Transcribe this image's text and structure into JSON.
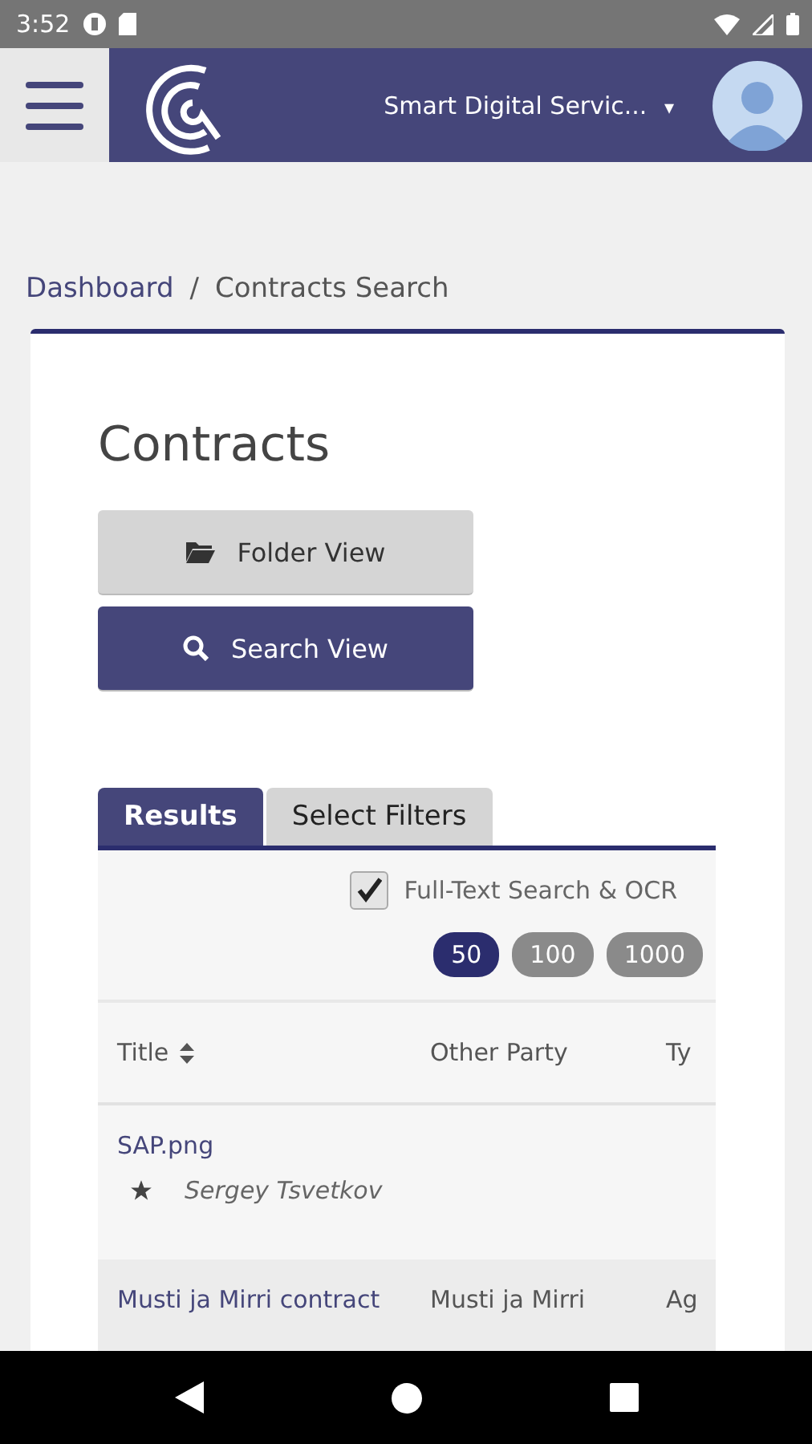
{
  "status_bar": {
    "time": "3:52"
  },
  "header": {
    "organization": "Smart Digital Servic...",
    "caret": "▾"
  },
  "breadcrumb": [
    {
      "label": "Dashboard",
      "kind": "link"
    },
    {
      "label": "Contracts Search",
      "kind": "current"
    }
  ],
  "breadcrumb_separator": "/",
  "page_title": "Contracts",
  "view_buttons": [
    {
      "label": "Folder View",
      "kind": "folder",
      "selected": false
    },
    {
      "label": "Search View",
      "kind": "search",
      "selected": true
    }
  ],
  "tabs": [
    {
      "label": "Results",
      "selected": true
    },
    {
      "label": "Select Filters",
      "selected": false
    }
  ],
  "full_text_search": {
    "label": "Full-Text Search & OCR",
    "checked": true
  },
  "page_sizes": [
    {
      "label": "50",
      "selected": true
    },
    {
      "label": "100",
      "selected": false
    },
    {
      "label": "1000",
      "selected": false
    }
  ],
  "table": {
    "columns": [
      {
        "label": "Title",
        "sortable": true
      },
      {
        "label": "Other Party",
        "sortable": false
      },
      {
        "label": "Ty",
        "sortable": false
      }
    ],
    "rows": [
      {
        "title": "SAP.png",
        "owner": "Sergey Tsvetkov",
        "other_party": "",
        "type": ""
      },
      {
        "title": "Musti ja Mirri contract",
        "other_party": "Musti ja Mirri",
        "type": "Ag"
      }
    ]
  }
}
